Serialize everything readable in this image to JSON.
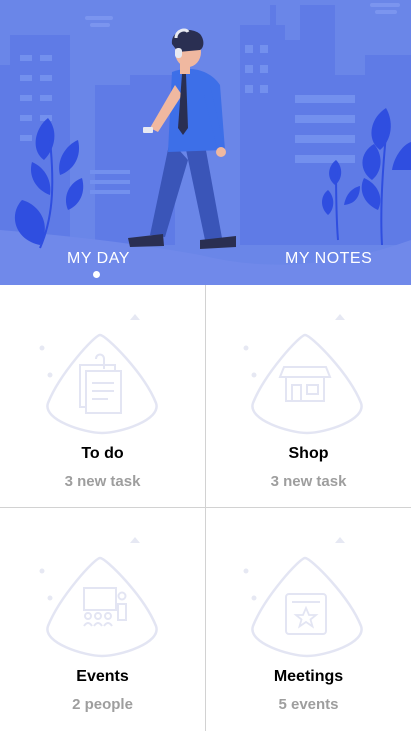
{
  "header": {
    "tabs": [
      {
        "label": "MY DAY",
        "active": true
      },
      {
        "label": "MY NOTES",
        "active": false
      }
    ]
  },
  "cards": [
    {
      "title": "To do",
      "subtitle": "3 new task",
      "icon": "notes-icon"
    },
    {
      "title": "Shop",
      "subtitle": "3 new task",
      "icon": "store-icon"
    },
    {
      "title": "Events",
      "subtitle": "2 people",
      "icon": "presentation-icon"
    },
    {
      "title": "Meetings",
      "subtitle": "5 events",
      "icon": "calendar-star-icon"
    }
  ],
  "colors": {
    "hero_background": "#6a86e8",
    "accent": "#3d5ee0",
    "card_subtitle": "#9e9e9e",
    "icon_line": "#e3e5f3"
  }
}
